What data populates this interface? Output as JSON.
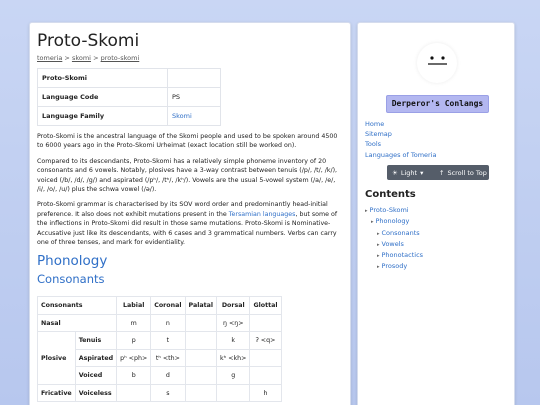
{
  "page": {
    "title": "Proto-Skomi",
    "breadcrumb": [
      "tomeria",
      "skomi",
      "proto-skomi"
    ],
    "breadcrumb_sep": ">"
  },
  "infobox": [
    {
      "key": "Proto-Skomi",
      "value": "",
      "link": false
    },
    {
      "key": "Language Code",
      "value": "PS",
      "link": false
    },
    {
      "key": "Language Family",
      "value": "Skomi",
      "link": true
    }
  ],
  "paragraphs": {
    "p1": "Proto-Skomi is the ancestral language of the Skomi people and used to be spoken around 4500 to 6000 years ago in the Proto-Skomi Urheimat (exact location still be worked on).",
    "p2": "Compared to its descendants, Proto-Skomi has a relatively simple phoneme inventory of 20 consonants and 6 vowels. Notably, plosives have a 3-way contrast between tenuis (/p/, /t/, /k/), voiced (/b/, /d/, /g/) and aspirated (/pʰ/, /tʰ/, /kʰ/). Vowels are the usual 5-vowel system (/a/, /e/, /i/, /o/, /u/) plus the schwa vowel (/ə/).",
    "p3_before": "Proto-Skomi grammar is characterised by its SOV word order and predominantly head-initial preference. It also does not exhibit mutations present in the ",
    "p3_link": "Tersamian languages",
    "p3_after": ", but some of the inflections in Proto-Skomi did result in those same mutations. Proto-Skomi is Nominative-Accusative just like its descendants, with 6 cases and 3 grammatical numbers. Verbs can carry one of three tenses, and mark for evidentiality."
  },
  "headings": {
    "phonology": "Phonology",
    "consonants": "Consonants"
  },
  "consonant_table": {
    "header": [
      "Consonants",
      "",
      "Labial",
      "Coronal",
      "Palatal",
      "Dorsal",
      "Glottal"
    ],
    "rows": [
      {
        "group": "Nasal",
        "sub": "",
        "cells": [
          "m",
          "n",
          "",
          "ŋ <ŋ>",
          ""
        ]
      },
      {
        "group": "Plosive",
        "sub": "Tenuis",
        "cells": [
          "p",
          "t",
          "",
          "k",
          "ʔ <q>"
        ]
      },
      {
        "group": "",
        "sub": "Aspirated",
        "cells": [
          "pʰ <ph>",
          "tʰ <th>",
          "",
          "kʰ <kh>",
          ""
        ]
      },
      {
        "group": "",
        "sub": "Voiced",
        "cells": [
          "b",
          "d",
          "",
          "g",
          ""
        ]
      },
      {
        "group": "Fricative",
        "sub": "Voiceless",
        "cells": [
          "",
          "s",
          "",
          "",
          "h"
        ]
      }
    ]
  },
  "sidebar": {
    "site_name": "Derperor's Conlangs",
    "links": [
      "Home",
      "Sitemap",
      "Tools",
      "Languages of Tomeria"
    ],
    "theme_label": "Light",
    "scroll_label": "Scroll to Top",
    "contents_title": "Contents",
    "toc": [
      {
        "label": "Proto-Skomi",
        "level": 0
      },
      {
        "label": "Phonology",
        "level": 1
      },
      {
        "label": "Consonants",
        "level": 2
      },
      {
        "label": "Vowels",
        "level": 2
      },
      {
        "label": "Phonotactics",
        "level": 2
      },
      {
        "label": "Prosody",
        "level": 2
      }
    ]
  },
  "colors": {
    "accent": "#2f6fc7",
    "site_badge": "#b3b7f0",
    "control_bar": "#555d69"
  }
}
